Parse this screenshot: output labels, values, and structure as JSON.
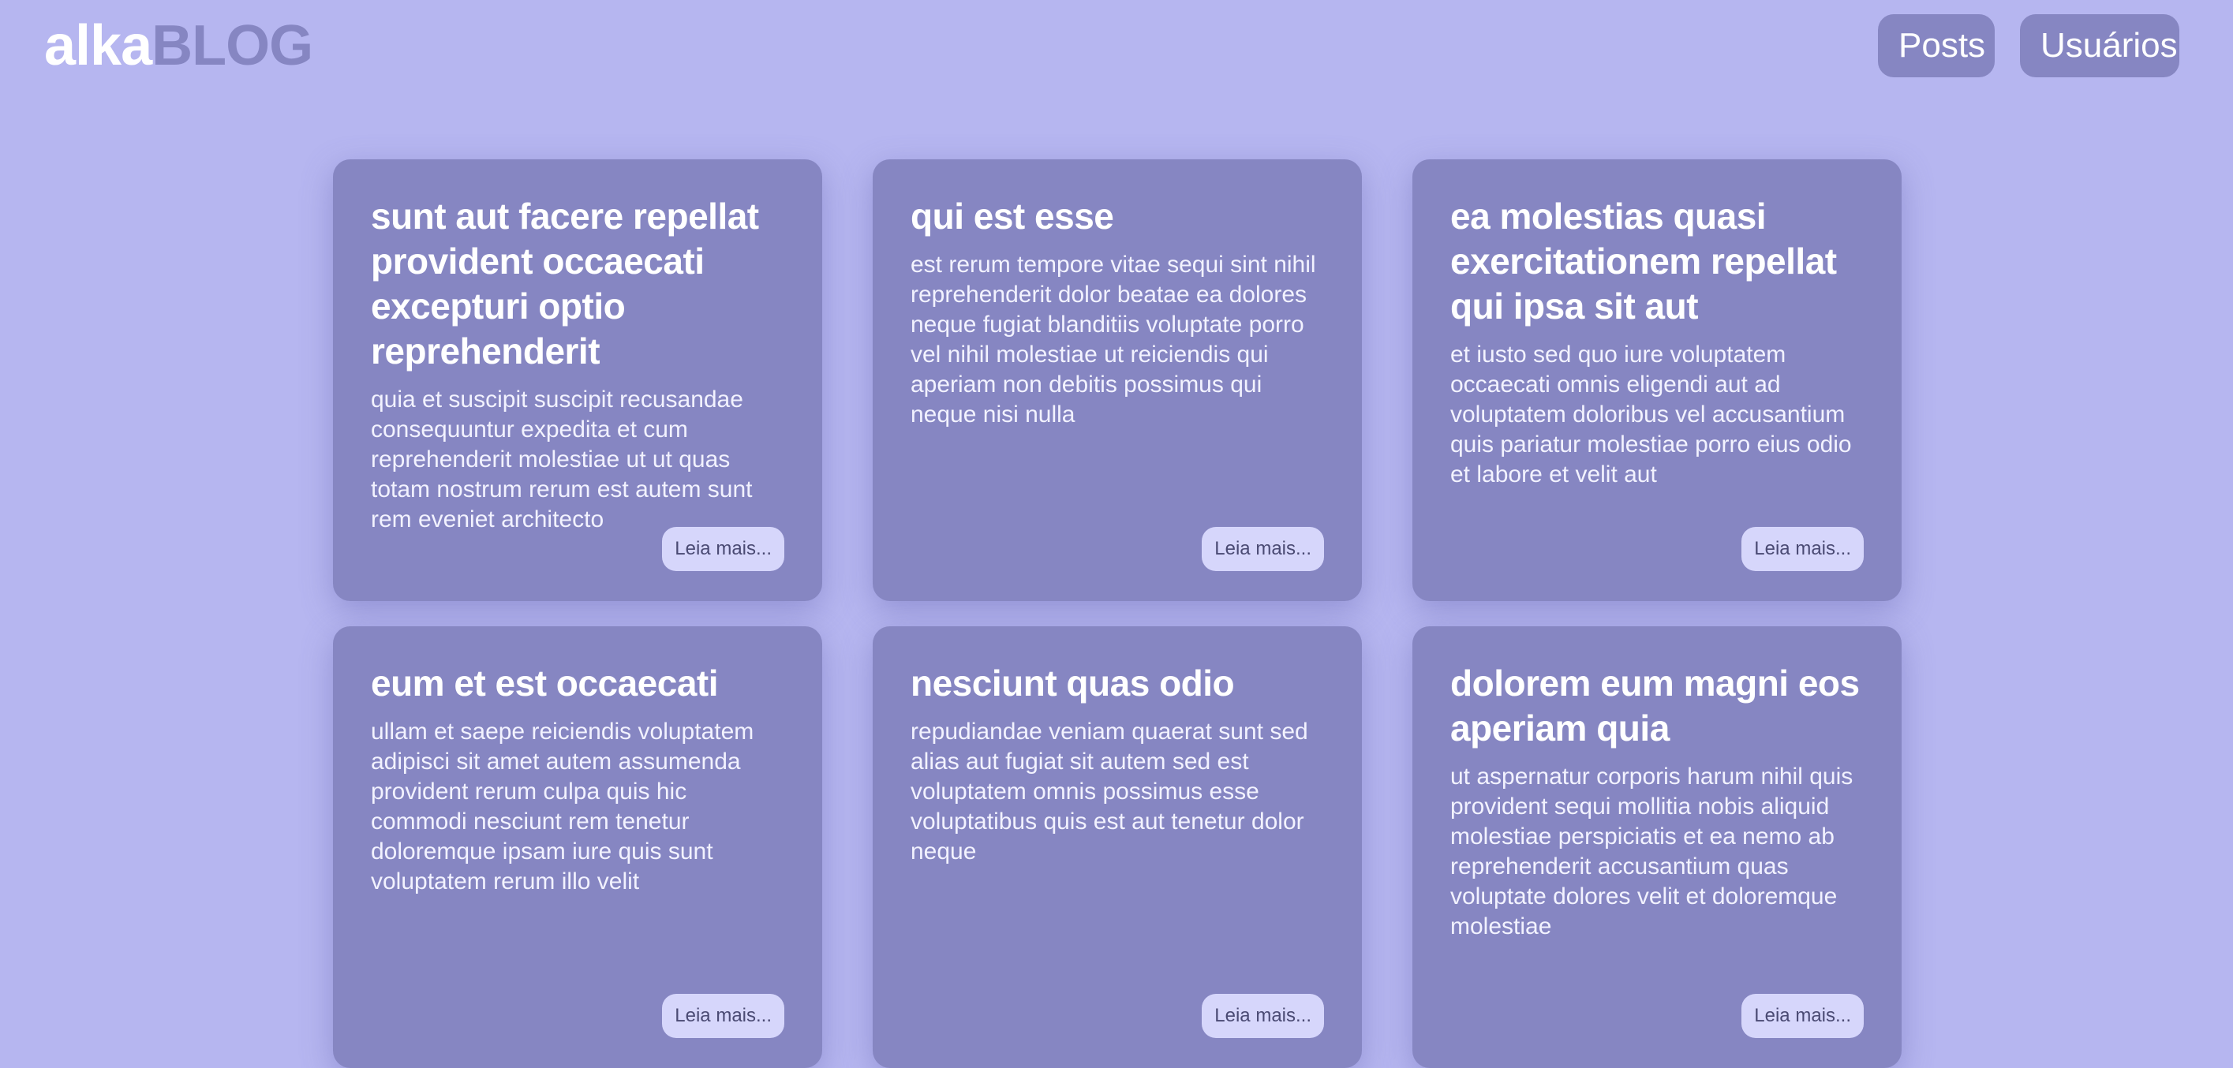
{
  "header": {
    "logo_part1": "alka",
    "logo_part2": "BLOG",
    "nav": [
      {
        "label": "Posts"
      },
      {
        "label": "Usuários"
      }
    ]
  },
  "colors": {
    "background": "#b6b6f0",
    "card": "#8686c2",
    "button": "#d6d6fb"
  },
  "posts": [
    {
      "title": "sunt aut facere repellat provident occaecati excepturi optio reprehenderit",
      "body": "quia et suscipit suscipit recusandae consequuntur expedita et cum reprehenderit molestiae ut ut quas totam nostrum rerum est autem sunt rem eveniet architecto",
      "button": "Leia mais..."
    },
    {
      "title": "qui est esse",
      "body": "est rerum tempore vitae sequi sint nihil reprehenderit dolor beatae ea dolores neque fugiat blanditiis voluptate porro vel nihil molestiae ut reiciendis qui aperiam non debitis possimus qui neque nisi nulla",
      "button": "Leia mais..."
    },
    {
      "title": "ea molestias quasi exercitationem repellat qui ipsa sit aut",
      "body": "et iusto sed quo iure voluptatem occaecati omnis eligendi aut ad voluptatem doloribus vel accusantium quis pariatur molestiae porro eius odio et labore et velit aut",
      "button": "Leia mais..."
    },
    {
      "title": "eum et est occaecati",
      "body": "ullam et saepe reiciendis voluptatem adipisci sit amet autem assumenda provident rerum culpa quis hic commodi nesciunt rem tenetur doloremque ipsam iure quis sunt voluptatem rerum illo velit",
      "button": "Leia mais..."
    },
    {
      "title": "nesciunt quas odio",
      "body": "repudiandae veniam quaerat sunt sed alias aut fugiat sit autem sed est voluptatem omnis possimus esse voluptatibus quis est aut tenetur dolor neque",
      "button": "Leia mais..."
    },
    {
      "title": "dolorem eum magni eos aperiam quia",
      "body": "ut aspernatur corporis harum nihil quis provident sequi mollitia nobis aliquid molestiae perspiciatis et ea nemo ab reprehenderit accusantium quas voluptate dolores velit et doloremque molestiae",
      "button": "Leia mais..."
    }
  ]
}
